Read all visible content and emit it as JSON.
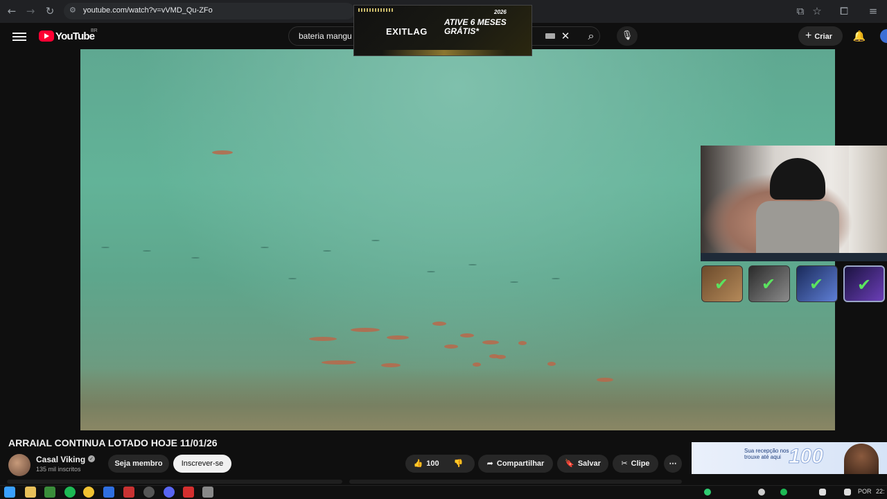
{
  "browser": {
    "url": "youtube.com/watch?v=vVMD_Qu-ZFo",
    "back_icon": "arrow-left-icon",
    "forward_icon": "arrow-right-icon",
    "reload_icon": "reload-icon"
  },
  "youtube": {
    "logo_text": "YouTube",
    "country_code": "BR",
    "search_query": "bateria mangu",
    "create_label": "Criar"
  },
  "ad_overlay": {
    "brand": "EXITLAG",
    "promo": "ATIVE 6 MESES GRÁTIS*",
    "year_tag": "2026"
  },
  "video": {
    "title": "ARRAIAL CONTINUA LOTADO HOJE 11/01/26"
  },
  "channel": {
    "name": "Casal Viking",
    "subscribers": "135 mil inscritos",
    "member_label": "Seja membro",
    "subscribe_label": "Inscrever-se"
  },
  "actions": {
    "likes": "100",
    "share_label": "Compartilhar",
    "save_label": "Salvar",
    "clip_label": "Clipe"
  },
  "banner_ad": {
    "text": "Sua recepção nos trouxe até aqui",
    "number": "100"
  },
  "taskbar": {
    "language": "POR",
    "time": "22:"
  },
  "colors": {
    "brand_red": "#ff0033",
    "check_green": "#5be35f",
    "water": "#62b398"
  }
}
